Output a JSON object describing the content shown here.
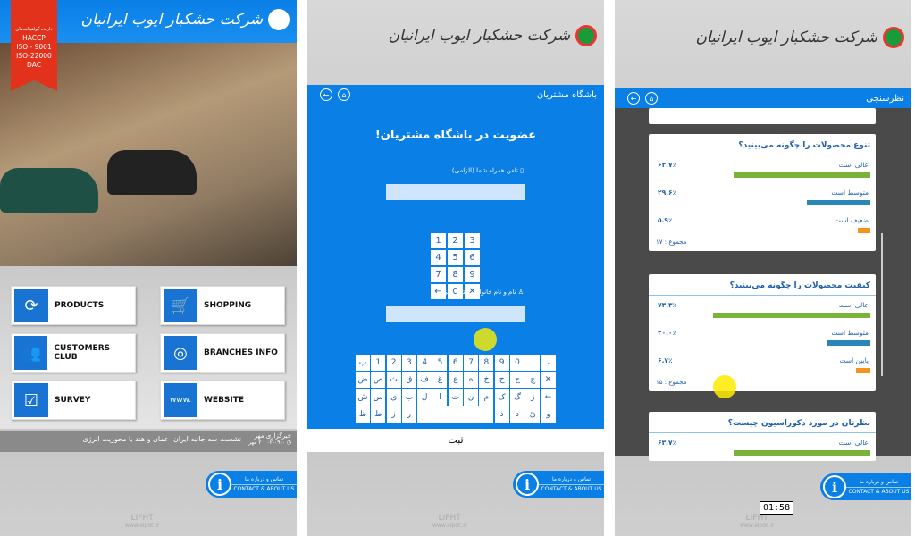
{
  "brand": {
    "name": "شرکت حشکبار ایوب ایرانیان",
    "accent": "#0a7fe6"
  },
  "contact": {
    "fa": "تماس و درباره ما",
    "en": "CONTACT & ABOUT US"
  },
  "watermark": {
    "name": "LIFHT",
    "url": "www.alpdc.ir"
  },
  "home": {
    "certs": {
      "title": "دارنده گواهینامه‌های",
      "items": [
        "HACCP",
        "ISO - 9001",
        "ISO-22000",
        "DAC"
      ]
    },
    "menu": [
      {
        "label": "PRODUCTS",
        "icon": "refresh-arrows-icon"
      },
      {
        "label": "SHOPPING",
        "icon": "shopping-cart-icon"
      },
      {
        "label": "CUSTOMERS CLUB",
        "icon": "people-group-icon"
      },
      {
        "label": "BRANCHES INFO",
        "icon": "globe-map-icon"
      },
      {
        "label": "SURVEY",
        "icon": "checklist-icon"
      },
      {
        "label": "WEBSITE",
        "icon": "www-browser-icon"
      }
    ],
    "news": {
      "source": "خبرگزاری مهر",
      "headline": "نشست سه جانبه ایران، عمان و هند با محوریت انرژی",
      "date": "۰۲-۰۹-۰ | ۲ مهر"
    }
  },
  "club": {
    "bar_title": "باشگاه مشتریان",
    "heading": "عضویت در باشگاه مشتریان!",
    "phone_label": "تلفن همراه شما (الزامی)",
    "phone_value": "",
    "name_label": "نام و نام خانوادگی شما (الزامی)",
    "name_value": "",
    "numpad": [
      "1",
      "2",
      "3",
      "4",
      "5",
      "6",
      "7",
      "8",
      "9",
      "←",
      "0",
      "✕"
    ],
    "keyboard": [
      [
        "پ",
        "1",
        "2",
        "3",
        "4",
        "5",
        "6",
        "7",
        "8",
        "9",
        "0",
        ".",
        "،"
      ],
      [
        "ض",
        "ص",
        "ث",
        "ق",
        "ف",
        "غ",
        "ع",
        "ه",
        "خ",
        "ح",
        "ج",
        "چ",
        "✕"
      ],
      [
        "ش",
        "س",
        "ی",
        "ب",
        "ل",
        "ا",
        "ت",
        "ن",
        "م",
        "ک",
        "گ",
        "ز",
        "←"
      ],
      [
        "ظ",
        "ط",
        "ز",
        "ر",
        " ",
        "ذ",
        "د",
        "ئ",
        "و"
      ]
    ],
    "submit": "ثبت"
  },
  "survey": {
    "bar_title": "نظرسنجی",
    "colors": {
      "excellent": "#7bb33a",
      "average": "#2a86b8",
      "weak": "#f6921e"
    },
    "cards": [
      {
        "question": "تنوع محصولات را چگونه می‌بینید؟",
        "options": [
          {
            "label": "عالی است",
            "value": "۶۳.۷٪",
            "pct": 63.7
          },
          {
            "label": "متوسط است",
            "value": "۲۹.۶٪",
            "pct": 29.6
          },
          {
            "label": "ضعیف است",
            "value": "۵.۹٪",
            "pct": 5.9
          }
        ],
        "total": "مجموع : ۱۷"
      },
      {
        "question": "کیفیت محصولات را چگونه می‌بینید؟",
        "options": [
          {
            "label": "عالی است",
            "value": "۷۳.۳٪",
            "pct": 73.3
          },
          {
            "label": "متوسط است",
            "value": "۲۰.۰٪",
            "pct": 20.0
          },
          {
            "label": "پایین است",
            "value": "۶.۷٪",
            "pct": 6.7
          }
        ],
        "total": "مجموع : ۱۵"
      },
      {
        "question": "نظرتان در مورد دکوراسیون چیست؟",
        "options": [
          {
            "label": "عالی است",
            "value": "۶۳.۷٪",
            "pct": 63.7
          }
        ],
        "total": ""
      }
    ]
  },
  "video_time": "01:58"
}
